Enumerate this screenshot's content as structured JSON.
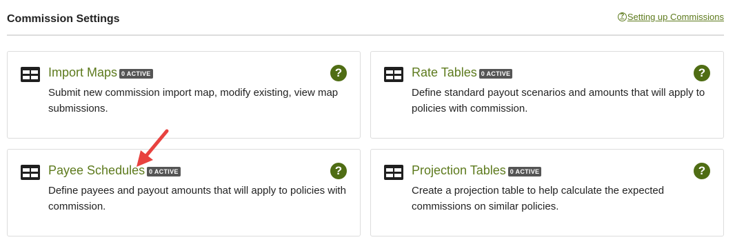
{
  "header": {
    "title": "Commission Settings",
    "help_link": "Setting up Commissions",
    "help_icon_glyph": "?"
  },
  "cards": [
    {
      "title": "Import Maps",
      "badge": "0 ACTIVE",
      "description": "Submit new commission import map, modify existing, view map submissions."
    },
    {
      "title": "Rate Tables",
      "badge": "0 ACTIVE",
      "description": "Define standard payout scenarios and amounts that will apply to policies with commission."
    },
    {
      "title": "Payee Schedules",
      "badge": "0 ACTIVE",
      "description": "Define payees and payout amounts that will apply to policies with commission."
    },
    {
      "title": "Projection Tables",
      "badge": "0 ACTIVE",
      "description": "Create a projection table to help calculate the expected commissions on similar policies."
    }
  ],
  "icons": {
    "card_icon": "table-icon",
    "help_icon": "question-circle-icon",
    "help_glyph": "?"
  },
  "colors": {
    "accent_green": "#5d7a1d",
    "help_icon_green": "#4f6d14",
    "badge_bg": "#555555",
    "annotation_arrow": "#e8423f"
  }
}
